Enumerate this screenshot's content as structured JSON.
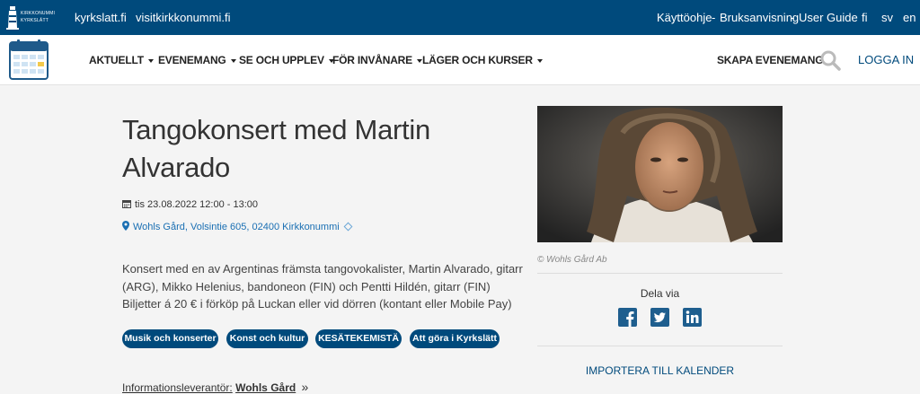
{
  "topbar": {
    "logo_line1": "KIRKKONUMMI",
    "logo_line2": "KYRKSLÄTT",
    "site_link": "kyrkslatt.fi",
    "visit_link": "visitkirkkonummi.fi",
    "guide_link1": "Käyttöohje",
    "guide_sep": "-",
    "guide_link2": "Bruksanvisning",
    "guide_link3": "User Guide",
    "lang_fi": "fi",
    "lang_sv": "sv",
    "lang_en": "en"
  },
  "nav": {
    "items": [
      "AKTUELLT",
      "EVENEMANG",
      "SE OCH UPPLEV",
      "FÖR INVÅNARE",
      "LÄGER OCH KURSER"
    ],
    "create_event": "SKAPA EVENEMANG",
    "login": "LOGGA IN"
  },
  "event": {
    "title": "Tangokonsert med Martin Alvarado",
    "date": "tis 23.08.2022 12:00 - 13:00",
    "location": "Wohls Gård, Volsintie 605, 02400 Kirkkonummi",
    "description_lines": [
      "Konsert med en av Argentinas främsta tangovokalister, Martin Alvarado, gitarr",
      "(ARG), Mikko Helenius, bandoneon (FIN) och Pentti Hildén, gitarr (FIN)",
      "Biljetter á 20 € i förköp på Luckan eller vid dörren (kontant eller Mobile Pay)"
    ],
    "tags": [
      "Musik och konserter",
      "Konst och kultur",
      "KESÄTEKEMISTÄ",
      "Att göra i Kyrkslätt"
    ],
    "info_label": "Informationsleverantör:",
    "info_value": "Wohls Gård",
    "info_arrow": "»",
    "photo_credit": "© Wohls Gård Ab"
  },
  "share": {
    "label": "Dela via",
    "icons": [
      "facebook-icon",
      "twitter-icon",
      "linkedin-icon"
    ],
    "import_calendar": "IMPORTERA TILL KALENDER"
  },
  "colors": {
    "brand": "#004a7c",
    "link": "#1a6fb3",
    "background": "#f4f4f4"
  }
}
